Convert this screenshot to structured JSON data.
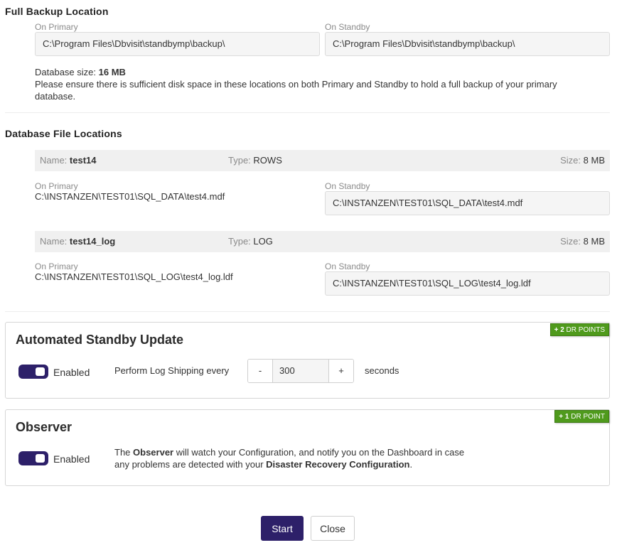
{
  "full_backup": {
    "title": "Full Backup Location",
    "primary_label": "On Primary",
    "primary_path": "C:\\Program Files\\Dbvisit\\standbymp\\backup\\",
    "standby_label": "On Standby",
    "standby_path": "C:\\Program Files\\Dbvisit\\standbymp\\backup\\",
    "db_size_label": "Database size:",
    "db_size_value": "16 MB",
    "note_line1": "Please ensure there is sufficient disk space in these locations on both Primary and Standby to hold a full backup of your primary",
    "note_line2": "database."
  },
  "db_files": {
    "title": "Database File Locations",
    "name_key": "Name:",
    "type_key": "Type:",
    "size_key": "Size:",
    "primary_label": "On Primary",
    "standby_label": "On Standby",
    "files": [
      {
        "name": "test14",
        "type": "ROWS",
        "size": "8 MB",
        "primary_path": "C:\\INSTANZEN\\TEST01\\SQL_DATA\\test4.mdf",
        "standby_path": "C:\\INSTANZEN\\TEST01\\SQL_DATA\\test4.mdf"
      },
      {
        "name": "test14_log",
        "type": "LOG",
        "size": "8 MB",
        "primary_path": "C:\\INSTANZEN\\TEST01\\SQL_LOG\\test4_log.ldf",
        "standby_path": "C:\\INSTANZEN\\TEST01\\SQL_LOG\\test4_log.ldf"
      }
    ]
  },
  "auto_update": {
    "title": "Automated Standby Update",
    "badge_bold": "+ 2",
    "badge_rest": "DR POINTS",
    "toggle_label": "Enabled",
    "toggle_on": true,
    "interval_prefix": "Perform Log Shipping every",
    "minus": "-",
    "interval_value": "300",
    "plus": "+",
    "interval_suffix": "seconds"
  },
  "observer": {
    "title": "Observer",
    "badge_bold": "+ 1",
    "badge_rest": "DR POINT",
    "toggle_label": "Enabled",
    "toggle_on": true,
    "desc_1": "The ",
    "desc_bold1": "Observer",
    "desc_2": " will watch your Configuration, and notify you on the Dashboard in case",
    "desc_3": "any problems are detected with your ",
    "desc_bold2": "Disaster Recovery Configuration",
    "desc_4": "."
  },
  "actions": {
    "start": "Start",
    "close": "Close"
  },
  "colors": {
    "accent": "#2d2069",
    "badge_green": "#4f9a1c"
  }
}
